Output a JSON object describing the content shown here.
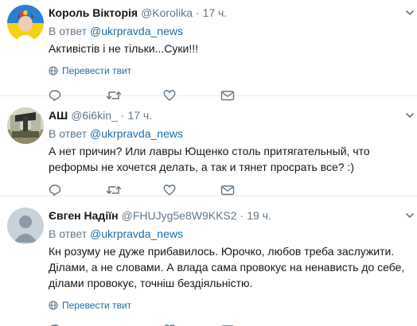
{
  "tweets": [
    {
      "name": "Король Вікторія",
      "handle": "@Korolika",
      "separator": "·",
      "time": "17 ч.",
      "reply_prefix": "В ответ",
      "reply_mention": "@ukrpravda_news",
      "text": "Активістів і не тільки...Суки!!!",
      "translate": "Перевести твит"
    },
    {
      "name": "АШ",
      "handle": "@6i6kin_",
      "separator": "·",
      "time": "17 ч.",
      "reply_prefix": "В ответ",
      "reply_mention": "@ukrpravda_news",
      "text": "А нет причин? Или лавры Ющенко столь притягательный,  что реформы не хочется делать,  а так и тянет просрать все?  :)"
    },
    {
      "name": "Євген Надіїн",
      "handle": "@FHUJyg5e8W9KKS2",
      "separator": "·",
      "time": "19 ч.",
      "reply_prefix": "В ответ",
      "reply_mention": "@ukrpravda_news",
      "text": "Кн розуму не дуже прибавилось. Юрочко, любов треба заслужити. Ділами, а не словами. А влада сама провокує на ненависть до себе, ділами провокує, точніш бездіяльністю.",
      "translate": "Перевести твит"
    }
  ],
  "colors": {
    "link": "#1b6ca8",
    "muted": "#657786",
    "text": "#14171a",
    "divider": "#e6ecf0"
  },
  "icons": [
    "reply-icon",
    "retweet-icon",
    "like-icon",
    "message-icon",
    "chevron-down-icon",
    "globe-icon"
  ]
}
